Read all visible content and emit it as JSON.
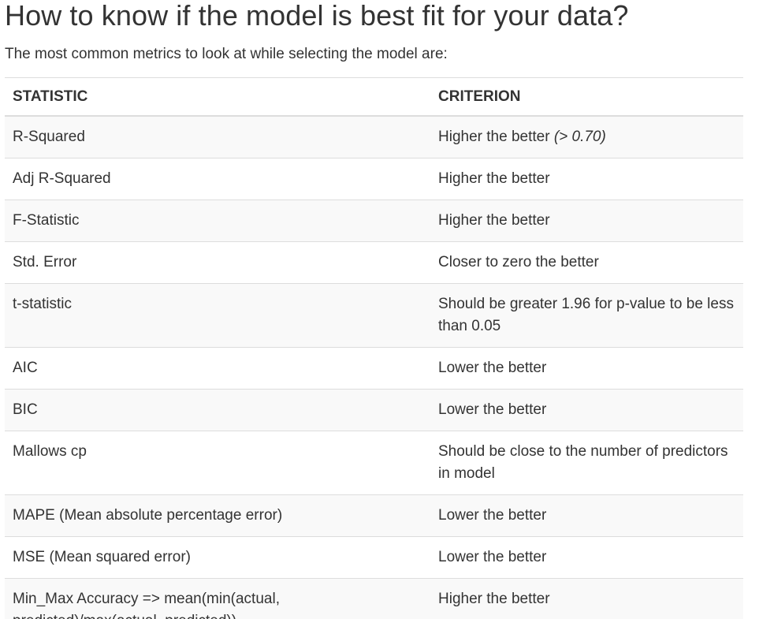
{
  "heading": "How to know if the model is best fit for your data?",
  "intro": "The most common metrics to look at while selecting the model are:",
  "table": {
    "headers": [
      "STATISTIC",
      "CRITERION"
    ],
    "rows": [
      {
        "statistic": "R-Squared",
        "criterion": "Higher the better",
        "note": "(> 0.70)"
      },
      {
        "statistic": "Adj R-Squared",
        "criterion": "Higher the better",
        "note": ""
      },
      {
        "statistic": "F-Statistic",
        "criterion": "Higher the better",
        "note": ""
      },
      {
        "statistic": "Std. Error",
        "criterion": "Closer to zero the better",
        "note": ""
      },
      {
        "statistic": "t-statistic",
        "criterion": "Should be greater 1.96 for p-value to be less than 0.05",
        "note": ""
      },
      {
        "statistic": "AIC",
        "criterion": "Lower the better",
        "note": ""
      },
      {
        "statistic": "BIC",
        "criterion": "Lower the better",
        "note": ""
      },
      {
        "statistic": "Mallows cp",
        "criterion": "Should be close to the number of predictors in model",
        "note": ""
      },
      {
        "statistic": "MAPE (Mean absolute percentage error)",
        "criterion": "Lower the better",
        "note": ""
      },
      {
        "statistic": "MSE (Mean squared error)",
        "criterion": "Lower the better",
        "note": ""
      },
      {
        "statistic": "Min_Max Accuracy => mean(min(actual, predicted)/max(actual, predicted))",
        "criterion": "Higher the better",
        "note": ""
      }
    ]
  }
}
